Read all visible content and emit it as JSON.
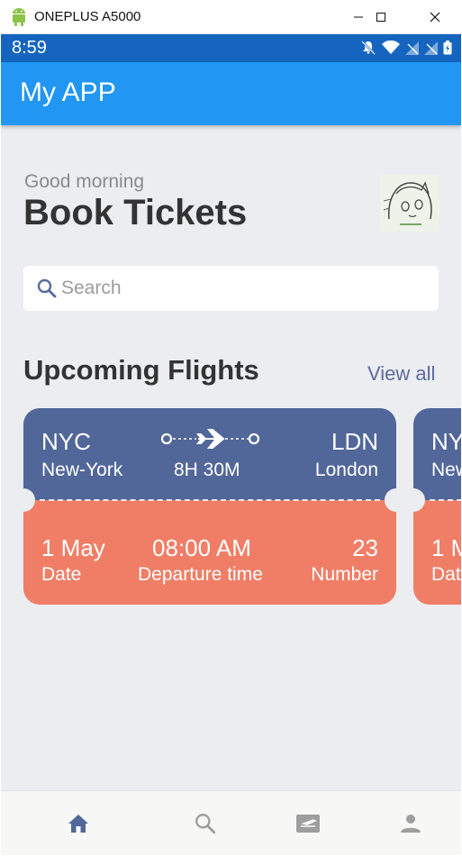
{
  "window": {
    "title": "ONEPLUS A5000"
  },
  "status_bar": {
    "time": "8:59"
  },
  "app_bar": {
    "title": "My APP"
  },
  "header": {
    "greeting": "Good morning",
    "title": "Book Tickets"
  },
  "search": {
    "placeholder": "Search"
  },
  "section": {
    "title": "Upcoming Flights",
    "action": "View all"
  },
  "flights": [
    {
      "from_code": "NYC",
      "from_city": "New-York",
      "to_code": "LDN",
      "to_city": "London",
      "duration": "8H 30M",
      "date": "1 May",
      "date_label": "Date",
      "time": "08:00 AM",
      "time_label": "Departure time",
      "number": "23",
      "number_label": "Number"
    },
    {
      "from_code": "NY",
      "from_city": "New",
      "date": "1 M",
      "date_label": "Dat"
    }
  ],
  "colors": {
    "app_bar": "#2196f3",
    "status_bar": "#1565c0",
    "card_top": "#526799",
    "card_bottom": "#f07e66",
    "accent": "#5b6b9e"
  },
  "bottom_nav": [
    {
      "icon": "home-icon",
      "active": true
    },
    {
      "icon": "search-icon"
    },
    {
      "icon": "ticket-icon"
    },
    {
      "icon": "person-icon"
    }
  ]
}
